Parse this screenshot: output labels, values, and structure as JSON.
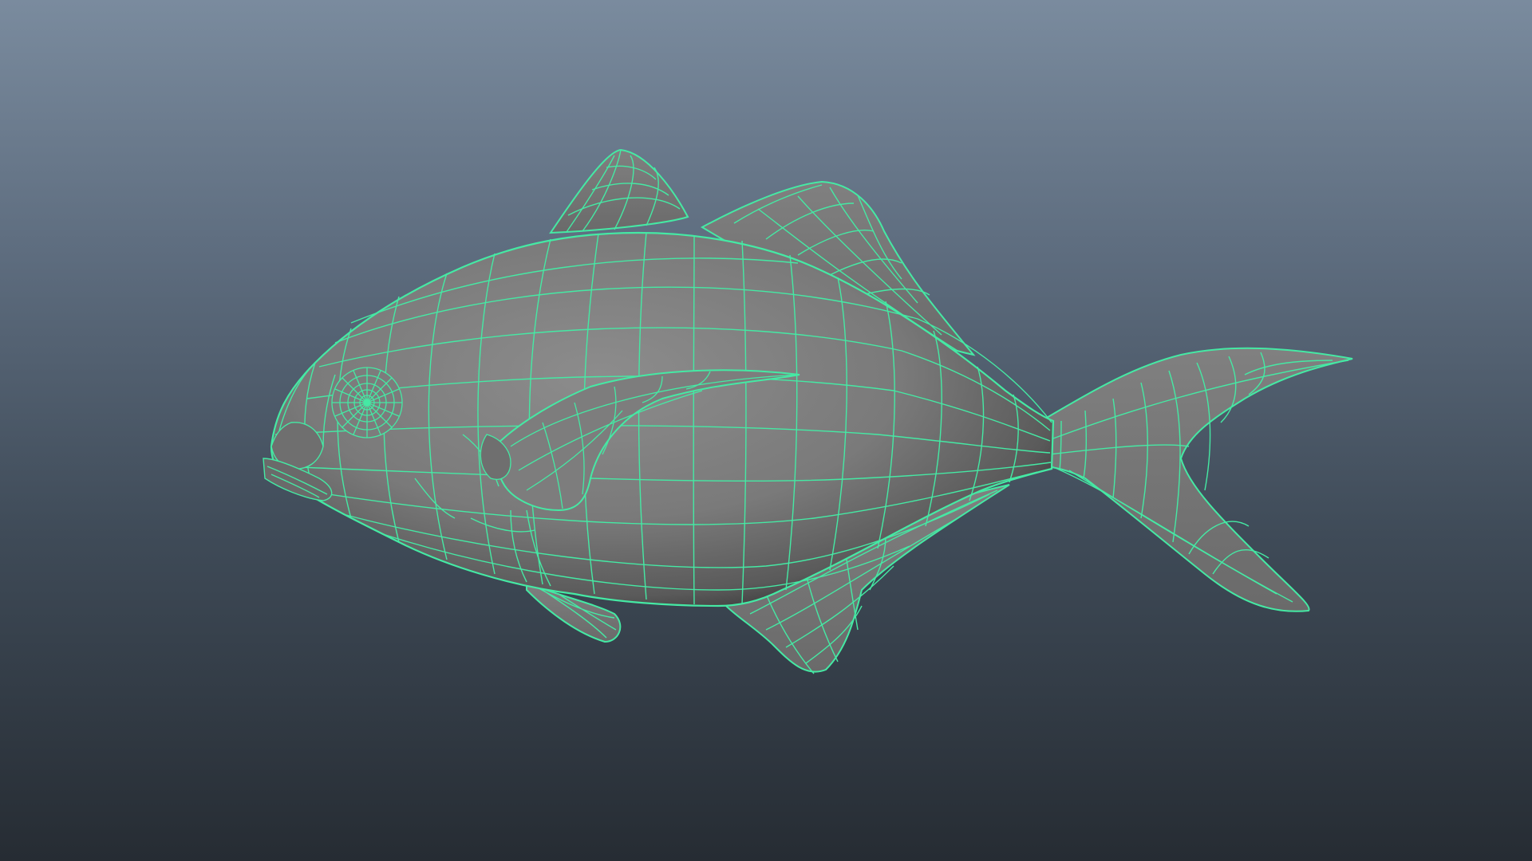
{
  "viewport": {
    "view": "perspective",
    "background_top": "#7a8b9e",
    "background_bottom": "#262c33"
  },
  "model": {
    "subject": "fish",
    "display_mode": "wireframe-on-shaded",
    "selected": true,
    "shade_color": "#808080",
    "wire_color": "#45e9a4"
  }
}
